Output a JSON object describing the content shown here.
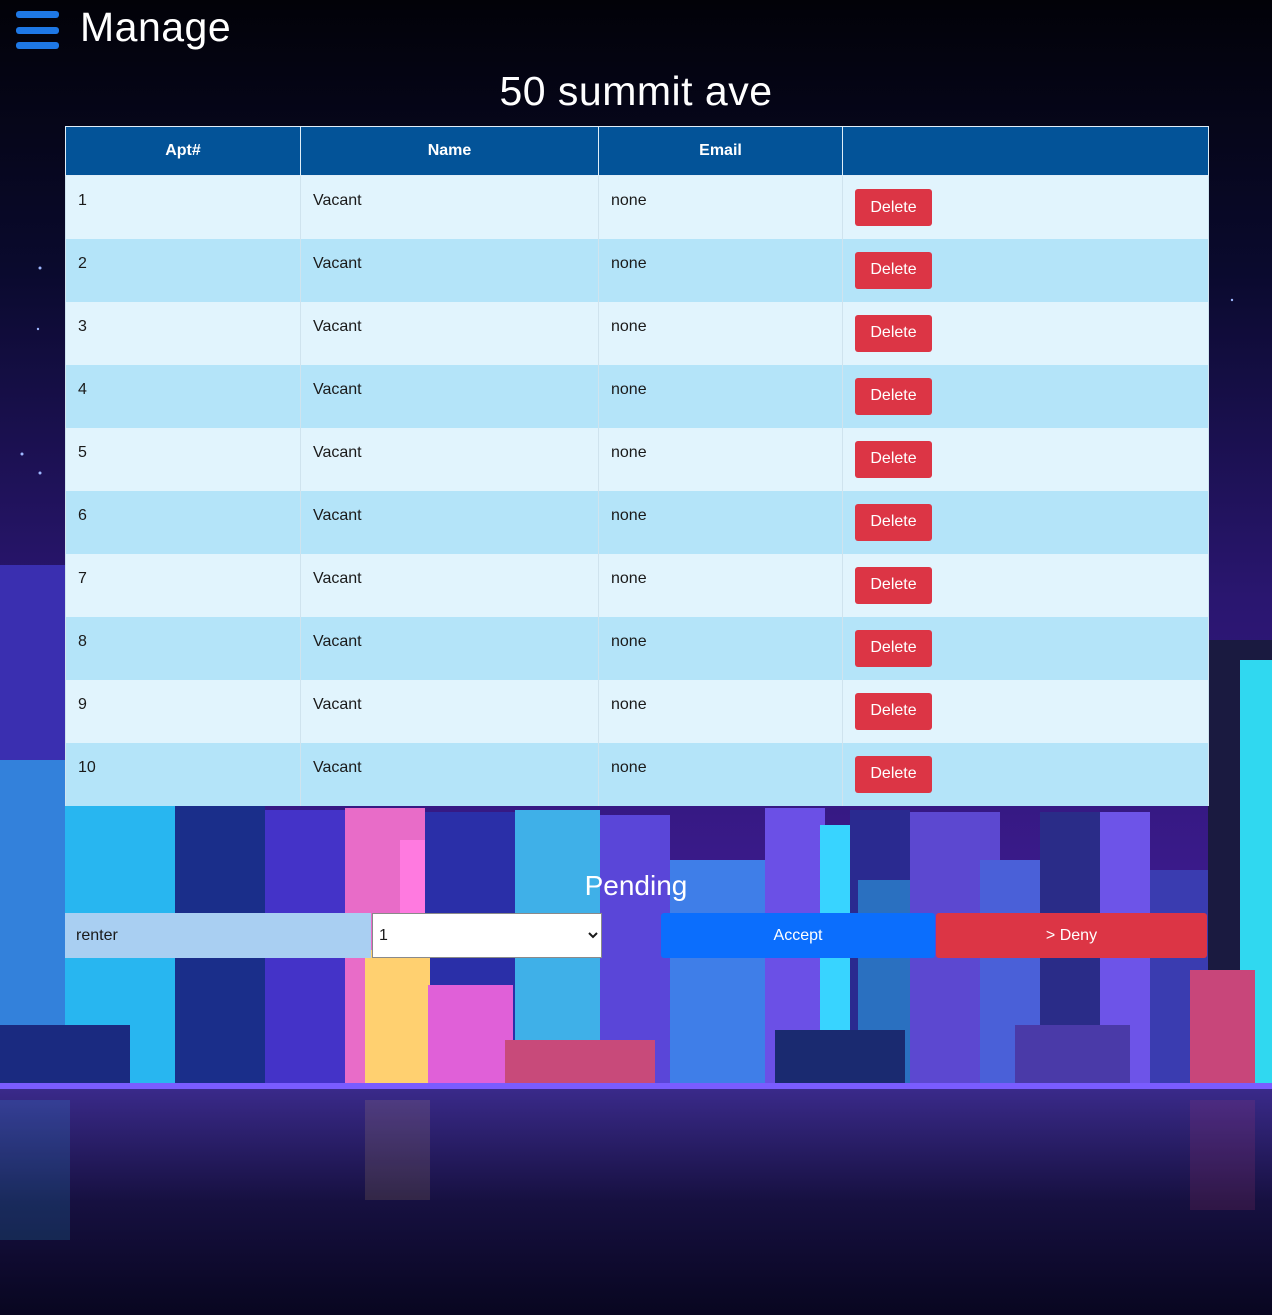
{
  "header": {
    "menu_icon": "hamburger-menu-icon",
    "title": "Manage"
  },
  "building": {
    "name": "50 summit ave"
  },
  "table": {
    "headers": [
      "Apt#",
      "Name",
      "Email",
      ""
    ],
    "rows": [
      {
        "apt": "1",
        "name": "Vacant",
        "email": "none",
        "action": "Delete"
      },
      {
        "apt": "2",
        "name": "Vacant",
        "email": "none",
        "action": "Delete"
      },
      {
        "apt": "3",
        "name": "Vacant",
        "email": "none",
        "action": "Delete"
      },
      {
        "apt": "4",
        "name": "Vacant",
        "email": "none",
        "action": "Delete"
      },
      {
        "apt": "5",
        "name": "Vacant",
        "email": "none",
        "action": "Delete"
      },
      {
        "apt": "6",
        "name": "Vacant",
        "email": "none",
        "action": "Delete"
      },
      {
        "apt": "7",
        "name": "Vacant",
        "email": "none",
        "action": "Delete"
      },
      {
        "apt": "8",
        "name": "Vacant",
        "email": "none",
        "action": "Delete"
      },
      {
        "apt": "9",
        "name": "Vacant",
        "email": "none",
        "action": "Delete"
      },
      {
        "apt": "10",
        "name": "Vacant",
        "email": "none",
        "action": "Delete"
      }
    ]
  },
  "pending": {
    "title": "Pending",
    "renter_value": "renter",
    "apt_select_value": "1",
    "accept_label": "Accept",
    "deny_label": "> Deny"
  },
  "colors": {
    "header_row": "#035398",
    "row_light": "#e1f4fd",
    "row_dark": "#b4e4f9",
    "delete": "#dc3545",
    "accept": "#0b6efd",
    "menu_icon": "#1e78e6"
  }
}
